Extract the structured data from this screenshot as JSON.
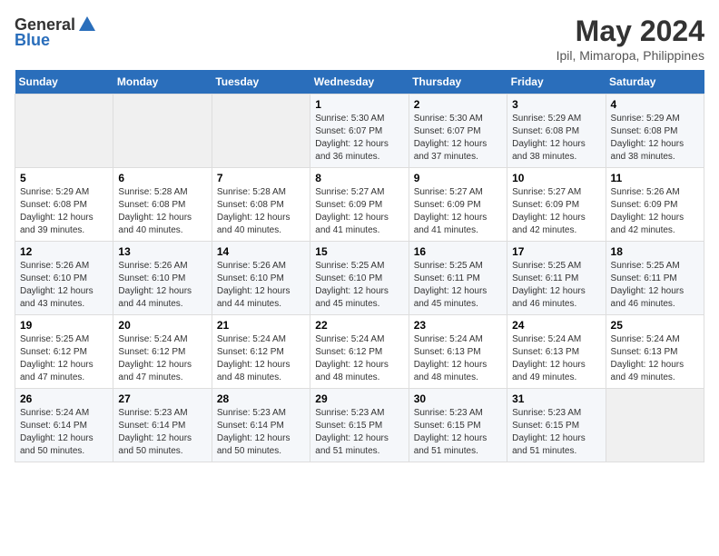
{
  "header": {
    "logo_general": "General",
    "logo_blue": "Blue",
    "title": "May 2024",
    "subtitle": "Ipil, Mimaropa, Philippines"
  },
  "days_of_week": [
    "Sunday",
    "Monday",
    "Tuesday",
    "Wednesday",
    "Thursday",
    "Friday",
    "Saturday"
  ],
  "weeks": [
    [
      {
        "day": "",
        "info": ""
      },
      {
        "day": "",
        "info": ""
      },
      {
        "day": "",
        "info": ""
      },
      {
        "day": "1",
        "info": "Sunrise: 5:30 AM\nSunset: 6:07 PM\nDaylight: 12 hours\nand 36 minutes."
      },
      {
        "day": "2",
        "info": "Sunrise: 5:30 AM\nSunset: 6:07 PM\nDaylight: 12 hours\nand 37 minutes."
      },
      {
        "day": "3",
        "info": "Sunrise: 5:29 AM\nSunset: 6:08 PM\nDaylight: 12 hours\nand 38 minutes."
      },
      {
        "day": "4",
        "info": "Sunrise: 5:29 AM\nSunset: 6:08 PM\nDaylight: 12 hours\nand 38 minutes."
      }
    ],
    [
      {
        "day": "5",
        "info": "Sunrise: 5:29 AM\nSunset: 6:08 PM\nDaylight: 12 hours\nand 39 minutes."
      },
      {
        "day": "6",
        "info": "Sunrise: 5:28 AM\nSunset: 6:08 PM\nDaylight: 12 hours\nand 40 minutes."
      },
      {
        "day": "7",
        "info": "Sunrise: 5:28 AM\nSunset: 6:08 PM\nDaylight: 12 hours\nand 40 minutes."
      },
      {
        "day": "8",
        "info": "Sunrise: 5:27 AM\nSunset: 6:09 PM\nDaylight: 12 hours\nand 41 minutes."
      },
      {
        "day": "9",
        "info": "Sunrise: 5:27 AM\nSunset: 6:09 PM\nDaylight: 12 hours\nand 41 minutes."
      },
      {
        "day": "10",
        "info": "Sunrise: 5:27 AM\nSunset: 6:09 PM\nDaylight: 12 hours\nand 42 minutes."
      },
      {
        "day": "11",
        "info": "Sunrise: 5:26 AM\nSunset: 6:09 PM\nDaylight: 12 hours\nand 42 minutes."
      }
    ],
    [
      {
        "day": "12",
        "info": "Sunrise: 5:26 AM\nSunset: 6:10 PM\nDaylight: 12 hours\nand 43 minutes."
      },
      {
        "day": "13",
        "info": "Sunrise: 5:26 AM\nSunset: 6:10 PM\nDaylight: 12 hours\nand 44 minutes."
      },
      {
        "day": "14",
        "info": "Sunrise: 5:26 AM\nSunset: 6:10 PM\nDaylight: 12 hours\nand 44 minutes."
      },
      {
        "day": "15",
        "info": "Sunrise: 5:25 AM\nSunset: 6:10 PM\nDaylight: 12 hours\nand 45 minutes."
      },
      {
        "day": "16",
        "info": "Sunrise: 5:25 AM\nSunset: 6:11 PM\nDaylight: 12 hours\nand 45 minutes."
      },
      {
        "day": "17",
        "info": "Sunrise: 5:25 AM\nSunset: 6:11 PM\nDaylight: 12 hours\nand 46 minutes."
      },
      {
        "day": "18",
        "info": "Sunrise: 5:25 AM\nSunset: 6:11 PM\nDaylight: 12 hours\nand 46 minutes."
      }
    ],
    [
      {
        "day": "19",
        "info": "Sunrise: 5:25 AM\nSunset: 6:12 PM\nDaylight: 12 hours\nand 47 minutes."
      },
      {
        "day": "20",
        "info": "Sunrise: 5:24 AM\nSunset: 6:12 PM\nDaylight: 12 hours\nand 47 minutes."
      },
      {
        "day": "21",
        "info": "Sunrise: 5:24 AM\nSunset: 6:12 PM\nDaylight: 12 hours\nand 48 minutes."
      },
      {
        "day": "22",
        "info": "Sunrise: 5:24 AM\nSunset: 6:12 PM\nDaylight: 12 hours\nand 48 minutes."
      },
      {
        "day": "23",
        "info": "Sunrise: 5:24 AM\nSunset: 6:13 PM\nDaylight: 12 hours\nand 48 minutes."
      },
      {
        "day": "24",
        "info": "Sunrise: 5:24 AM\nSunset: 6:13 PM\nDaylight: 12 hours\nand 49 minutes."
      },
      {
        "day": "25",
        "info": "Sunrise: 5:24 AM\nSunset: 6:13 PM\nDaylight: 12 hours\nand 49 minutes."
      }
    ],
    [
      {
        "day": "26",
        "info": "Sunrise: 5:24 AM\nSunset: 6:14 PM\nDaylight: 12 hours\nand 50 minutes."
      },
      {
        "day": "27",
        "info": "Sunrise: 5:23 AM\nSunset: 6:14 PM\nDaylight: 12 hours\nand 50 minutes."
      },
      {
        "day": "28",
        "info": "Sunrise: 5:23 AM\nSunset: 6:14 PM\nDaylight: 12 hours\nand 50 minutes."
      },
      {
        "day": "29",
        "info": "Sunrise: 5:23 AM\nSunset: 6:15 PM\nDaylight: 12 hours\nand 51 minutes."
      },
      {
        "day": "30",
        "info": "Sunrise: 5:23 AM\nSunset: 6:15 PM\nDaylight: 12 hours\nand 51 minutes."
      },
      {
        "day": "31",
        "info": "Sunrise: 5:23 AM\nSunset: 6:15 PM\nDaylight: 12 hours\nand 51 minutes."
      },
      {
        "day": "",
        "info": ""
      }
    ]
  ]
}
